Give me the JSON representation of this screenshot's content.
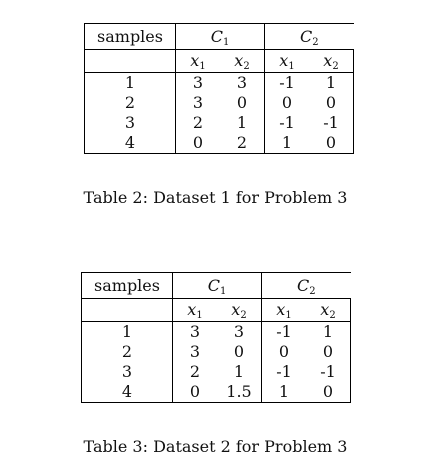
{
  "tables": [
    {
      "headers": {
        "samples": "samples",
        "class1": "C",
        "class1_sub": "1",
        "class2": "C",
        "class2_sub": "2",
        "feat_var": "x",
        "feat1_sub": "1",
        "feat2_sub": "2"
      },
      "rows": [
        {
          "sample": "1",
          "c1x1": "3",
          "c1x2": "3",
          "c2x1": "-1",
          "c2x2": "1"
        },
        {
          "sample": "2",
          "c1x1": "3",
          "c1x2": "0",
          "c2x1": "0",
          "c2x2": "0"
        },
        {
          "sample": "3",
          "c1x1": "2",
          "c1x2": "1",
          "c2x1": "-1",
          "c2x2": "-1"
        },
        {
          "sample": "4",
          "c1x1": "0",
          "c1x2": "2",
          "c2x1": "1",
          "c2x2": "0"
        }
      ],
      "caption": "Table 2: Dataset 1 for Problem 3"
    },
    {
      "headers": {
        "samples": "samples",
        "class1": "C",
        "class1_sub": "1",
        "class2": "C",
        "class2_sub": "2",
        "feat_var": "x",
        "feat1_sub": "1",
        "feat2_sub": "2"
      },
      "rows": [
        {
          "sample": "1",
          "c1x1": "3",
          "c1x2": "3",
          "c2x1": "-1",
          "c2x2": "1"
        },
        {
          "sample": "2",
          "c1x1": "3",
          "c1x2": "0",
          "c2x1": "0",
          "c2x2": "0"
        },
        {
          "sample": "3",
          "c1x1": "2",
          "c1x2": "1",
          "c2x1": "-1",
          "c2x2": "-1"
        },
        {
          "sample": "4",
          "c1x1": "0",
          "c1x2": "1.5",
          "c2x1": "1",
          "c2x2": "0"
        }
      ],
      "caption": "Table 3: Dataset 2 for Problem 3"
    }
  ]
}
